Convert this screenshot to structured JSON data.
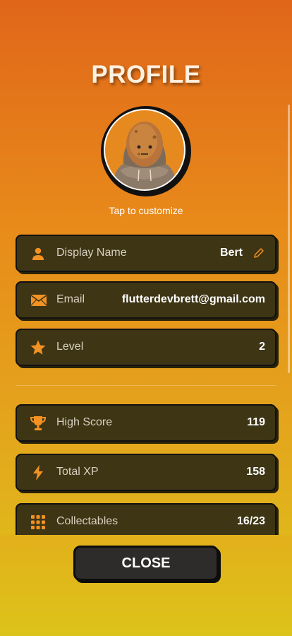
{
  "header": {
    "title": "PROFILE"
  },
  "avatar": {
    "caption": "Tap to customize",
    "icon": "potato-avatar-icon"
  },
  "profile_rows": [
    {
      "icon": "person-icon",
      "label": "Display Name",
      "value": "Bert"
    },
    {
      "icon": "envelope-icon",
      "label": "Email",
      "value": "flutterdevbrett@gmail.com"
    },
    {
      "icon": "star-icon",
      "label": "Level",
      "value": "2"
    }
  ],
  "stats_rows": [
    {
      "icon": "trophy-icon",
      "label": "High Score",
      "value": "119"
    },
    {
      "icon": "lightning-icon",
      "label": "Total XP",
      "value": "158"
    },
    {
      "icon": "grid-icon",
      "label": "Collectables",
      "value": "16/23"
    }
  ],
  "footer": {
    "close_label": "CLOSE"
  },
  "colors": {
    "accent": "#f39223",
    "card_bg": "#3e3515",
    "button_bg": "#2e2c2a"
  }
}
